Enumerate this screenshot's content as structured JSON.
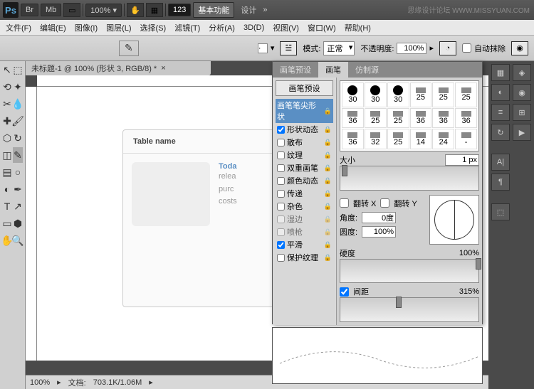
{
  "titlebar": {
    "logo": "Ps",
    "br": "Br",
    "mb": "Mb",
    "zoom": "100%",
    "num": "123",
    "btn_basic": "基本功能",
    "btn_design": "设计",
    "more": "»",
    "watermark": "思缘设计论坛 WWW.MISSYUAN.COM"
  },
  "menu": [
    "文件(F)",
    "编辑(E)",
    "图像(I)",
    "图层(L)",
    "选择(S)",
    "滤镜(T)",
    "分析(A)",
    "3D(D)",
    "视图(V)",
    "窗口(W)",
    "帮助(H)"
  ],
  "optbar": {
    "mode_label": "模式:",
    "mode_val": "正常",
    "opacity_label": "不透明度:",
    "opacity_val": "100%",
    "autoerase": "自动抹除"
  },
  "doc": {
    "tab": "未标题-1 @ 100% (形状 3, RGB/8) *"
  },
  "artboard": {
    "table_name": "Table name",
    "today": "Toda",
    "l1": "relea",
    "l2": "purc",
    "l3": "costs"
  },
  "status": {
    "zoom": "100%",
    "doc": "文档:",
    "size": "703.1K/1.06M"
  },
  "brush_panel": {
    "tabs": [
      "画笔预设",
      "画笔",
      "仿制源"
    ],
    "preset_btn": "画笔预设",
    "items": [
      {
        "label": "画笔笔尖形状",
        "sel": true,
        "cb": false
      },
      {
        "label": "形状动态",
        "cb": true
      },
      {
        "label": "散布",
        "cb": false
      },
      {
        "label": "纹理",
        "cb": false
      },
      {
        "label": "双重画笔",
        "cb": false
      },
      {
        "label": "颜色动态",
        "cb": false
      },
      {
        "label": "传递",
        "cb": false
      },
      {
        "label": "杂色",
        "cb": false
      },
      {
        "label": "湿边",
        "cb": false,
        "dis": true
      },
      {
        "label": "喷枪",
        "cb": false,
        "dis": true
      },
      {
        "label": "平滑",
        "cb": true
      },
      {
        "label": "保护纹理",
        "cb": false
      }
    ],
    "brushes": [
      {
        "s": "30",
        "t": "dot"
      },
      {
        "s": "30",
        "t": "dot"
      },
      {
        "s": "30",
        "t": "dot"
      },
      {
        "s": "25",
        "t": "sq"
      },
      {
        "s": "25",
        "t": "sq"
      },
      {
        "s": "25",
        "t": "sq"
      },
      {
        "s": "36",
        "t": "sq"
      },
      {
        "s": "25",
        "t": "sq"
      },
      {
        "s": "25",
        "t": "sq"
      },
      {
        "s": "36",
        "t": "sq"
      },
      {
        "s": "36",
        "t": "sq"
      },
      {
        "s": "36",
        "t": "sq"
      },
      {
        "s": "36",
        "t": "sq"
      },
      {
        "s": "32",
        "t": "sq"
      },
      {
        "s": "25",
        "t": "sq"
      },
      {
        "s": "14",
        "t": "sq"
      },
      {
        "s": "24",
        "t": "sq"
      },
      {
        "s": "-",
        "t": "sq"
      }
    ],
    "size_label": "大小",
    "size_val": "1 px",
    "flipx": "翻转 X",
    "flipy": "翻转 Y",
    "angle_label": "角度:",
    "angle_val": "0度",
    "round_label": "圆度:",
    "round_val": "100%",
    "hard_label": "硬度",
    "hard_val": "100%",
    "spacing_label": "间距",
    "spacing_val": "315%"
  }
}
